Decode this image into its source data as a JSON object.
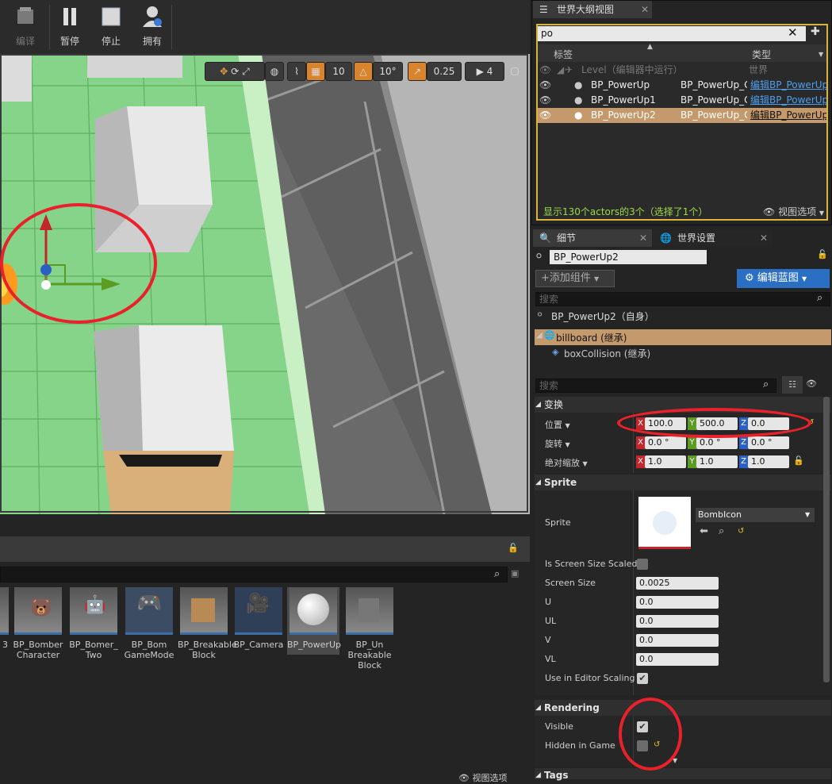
{
  "toolbar": {
    "compile_label": "编译",
    "pause_label": "暂停",
    "stop_label": "停止",
    "possess_label": "拥有"
  },
  "viewport": {
    "grid_value": "10",
    "rotation_value": "10°",
    "scale_value": "0.25",
    "camera_speed": "4"
  },
  "content_browser": {
    "assets": [
      {
        "label": "3"
      },
      {
        "label": "BP_Bomber\nCharacter"
      },
      {
        "label": "BP_Bomer_\nTwo"
      },
      {
        "label": "BP_Bom\nGameMode"
      },
      {
        "label": "BP_Breakable\nBlock"
      },
      {
        "label": "BP_Camera"
      },
      {
        "label": "BP_PowerUp"
      },
      {
        "label": "BP_Un\nBreakable\nBlock"
      }
    ],
    "view_options": "视图选项"
  },
  "outliner": {
    "tab_title": "世界大纲视图",
    "search_value": "po",
    "col_label": "标签",
    "col_type": "类型",
    "rows": [
      {
        "label": "Level（编辑器中运行）",
        "type": "世界",
        "link": ""
      },
      {
        "label": "BP_PowerUp",
        "type": "BP_PowerUp_C",
        "link": "编辑BP_PowerUp"
      },
      {
        "label": "BP_PowerUp1",
        "type": "BP_PowerUp_C",
        "link": "编辑BP_PowerUp"
      },
      {
        "label": "BP_PowerUp2",
        "type": "BP_PowerUp_C",
        "link": "编辑BP_PowerUp"
      }
    ],
    "status": "显示130个actors的3个（选择了1个）",
    "view_options": "视图选项"
  },
  "details": {
    "tab_details": "细节",
    "tab_world_settings": "世界设置",
    "actor_name": "BP_PowerUp2",
    "add_component": "+添加组件",
    "edit_blueprint": "编辑蓝图",
    "search_placeholder": "搜索",
    "self_label": "BP_PowerUp2（自身）",
    "components": [
      {
        "label": "billboard (继承)"
      },
      {
        "label": "boxCollision (继承)"
      }
    ],
    "search2_placeholder": "搜索",
    "transform": {
      "section": "变换",
      "location_label": "位置",
      "rotation_label": "旋转",
      "scale_label": "绝对缩放",
      "location": {
        "x": "100.0",
        "y": "500.0",
        "z": "0.0"
      },
      "rotation": {
        "x": "0.0 °",
        "y": "0.0 °",
        "z": "0.0 °"
      },
      "scale": {
        "x": "1.0",
        "y": "1.0",
        "z": "1.0"
      }
    },
    "sprite": {
      "section": "Sprite",
      "sprite_label": "Sprite",
      "sprite_asset": "BombIcon",
      "screen_size_scaled_label": "Is Screen Size Scaled",
      "screen_size_label": "Screen Size",
      "screen_size": "0.0025",
      "u_label": "U",
      "u": "0.0",
      "ul_label": "UL",
      "ul": "0.0",
      "v_label": "V",
      "v": "0.0",
      "vl_label": "VL",
      "vl": "0.0",
      "editor_scaling_label": "Use in Editor Scaling"
    },
    "rendering": {
      "section": "Rendering",
      "visible_label": "Visible",
      "hidden_label": "Hidden in Game"
    },
    "tags_section": "Tags"
  },
  "colors": {
    "accent_blue": "#2a6fc4",
    "selection": "#c49a6c",
    "annotation_red": "#e8212b",
    "axis_x": "#c1272d",
    "axis_y": "#5b9c22",
    "axis_z": "#2a5fc4"
  }
}
